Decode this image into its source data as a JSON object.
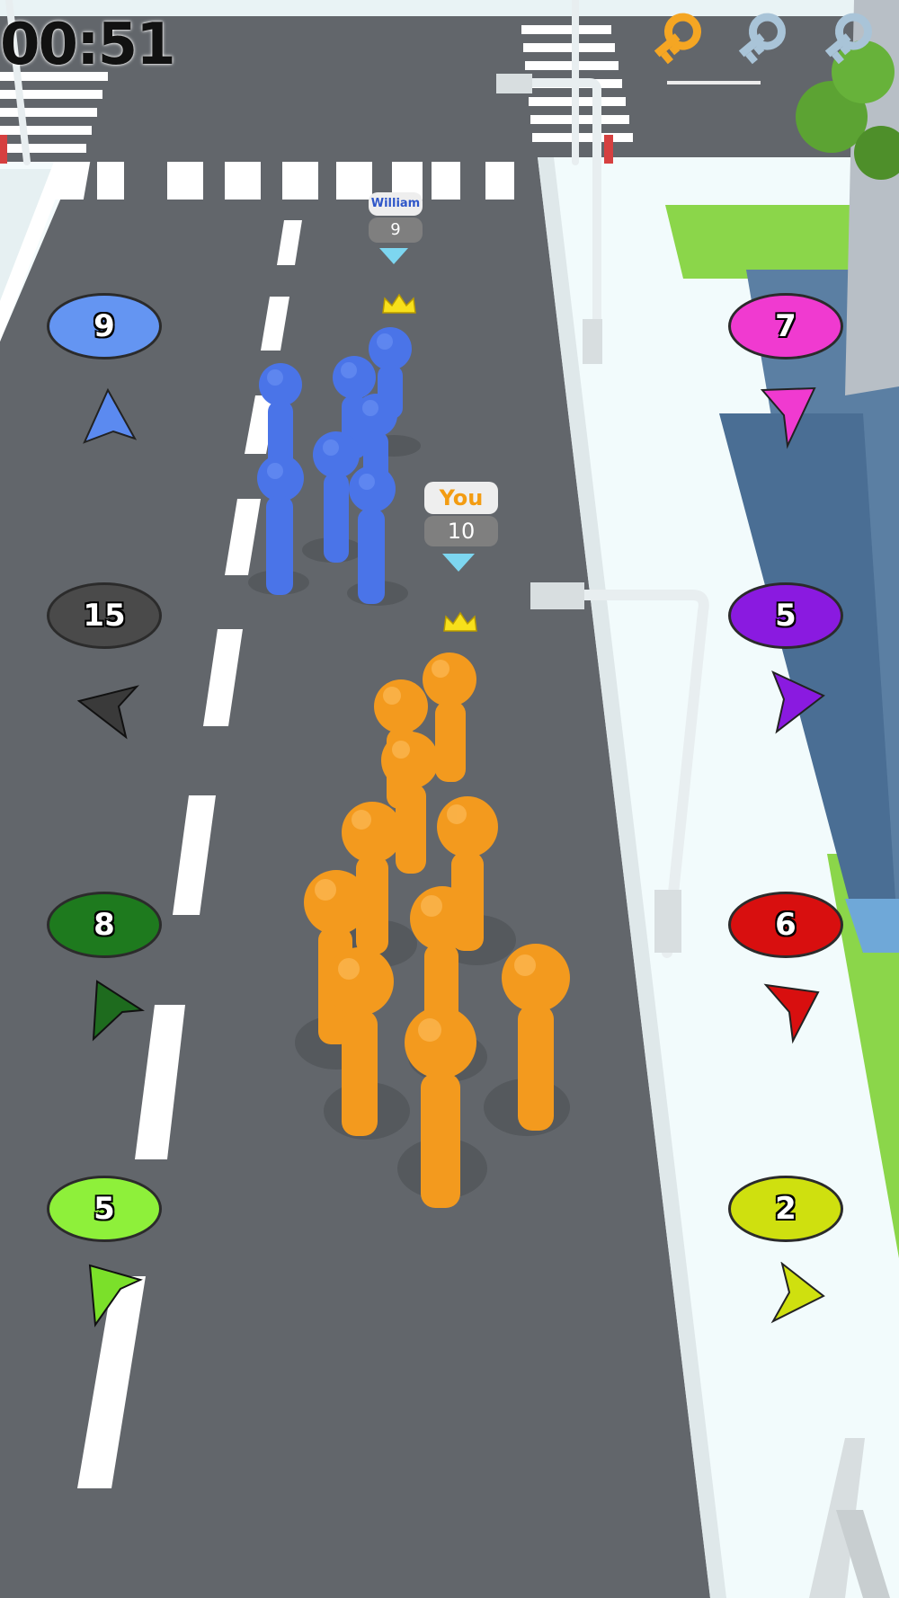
{
  "hud": {
    "timer": "00:51",
    "keys": [
      {
        "icon": "key-icon",
        "state": "collected",
        "color": "#f5a623"
      },
      {
        "icon": "key-icon",
        "state": "empty",
        "color": "#a9c4d8"
      },
      {
        "icon": "key-icon",
        "state": "empty",
        "color": "#a9c4d8"
      }
    ]
  },
  "opponent": {
    "name": "William",
    "count": "9",
    "color": "#4f7df0"
  },
  "player": {
    "name": "You",
    "count": "10",
    "color": "#f39c12"
  },
  "side_markers": {
    "left": [
      {
        "value": "9",
        "color": "#6495f2",
        "arrow_color": "#5b8af0"
      },
      {
        "value": "15",
        "color": "#4a4a4a",
        "arrow_color": "#3a3a3a"
      },
      {
        "value": "8",
        "color": "#1e7a1e",
        "arrow_color": "#1e6b1e"
      },
      {
        "value": "5",
        "color": "#8ef03a",
        "arrow_color": "#7be02a"
      }
    ],
    "right": [
      {
        "value": "7",
        "color": "#f03ad0",
        "arrow_color": "#f03ad0"
      },
      {
        "value": "5",
        "color": "#8a1ae0",
        "arrow_color": "#8a1ae0"
      },
      {
        "value": "6",
        "color": "#d80f0f",
        "arrow_color": "#d80f0f"
      },
      {
        "value": "2",
        "color": "#cfe00f",
        "arrow_color": "#cfe00f"
      }
    ]
  }
}
